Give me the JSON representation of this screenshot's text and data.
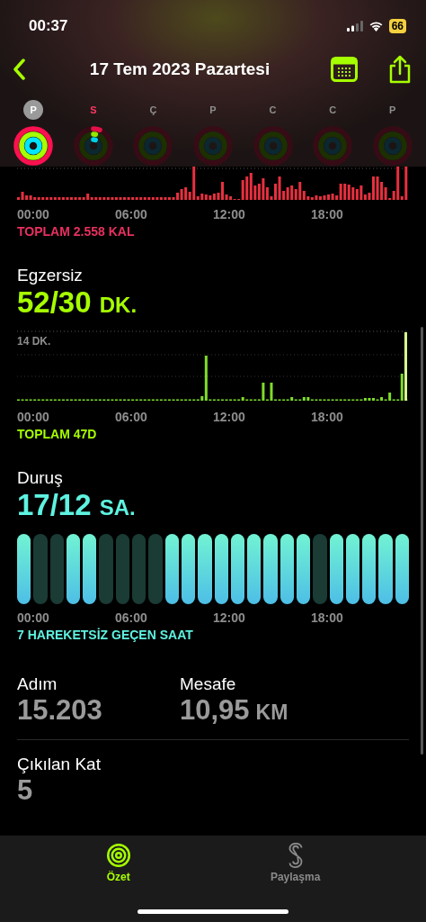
{
  "status_bar": {
    "time": "00:37",
    "battery": "66"
  },
  "nav": {
    "title": "17 Tem 2023 Pazartesi"
  },
  "week": [
    {
      "label": "P",
      "selected": true,
      "accent": false,
      "kind": "closed"
    },
    {
      "label": "S",
      "selected": false,
      "accent": true,
      "kind": "started"
    },
    {
      "label": "Ç",
      "selected": false,
      "accent": false,
      "kind": "empty"
    },
    {
      "label": "P",
      "selected": false,
      "accent": false,
      "kind": "empty"
    },
    {
      "label": "C",
      "selected": false,
      "accent": false,
      "kind": "empty"
    },
    {
      "label": "C",
      "selected": false,
      "accent": false,
      "kind": "empty"
    },
    {
      "label": "P",
      "selected": false,
      "accent": false,
      "kind": "empty"
    }
  ],
  "move": {
    "axis": [
      "00:00",
      "06:00",
      "12:00",
      "18:00"
    ],
    "total": "TOPLAM 2.558 KAL"
  },
  "exercise": {
    "title": "Egzersiz",
    "value": "52/30",
    "unit": "DK.",
    "scale_label": "14 DK.",
    "axis": [
      "00:00",
      "06:00",
      "12:00",
      "18:00"
    ],
    "total": "TOPLAM 47D"
  },
  "stand": {
    "title": "Duruş",
    "value": "17/12",
    "unit": "SA.",
    "hours": [
      {
        "stood": true
      },
      {
        "stood": false
      },
      {
        "stood": false
      },
      {
        "stood": true
      },
      {
        "stood": true
      },
      {
        "stood": false
      },
      {
        "stood": false
      },
      {
        "stood": false
      },
      {
        "stood": false
      },
      {
        "stood": true
      },
      {
        "stood": true
      },
      {
        "stood": true
      },
      {
        "stood": true
      },
      {
        "stood": true
      },
      {
        "stood": true
      },
      {
        "stood": true
      },
      {
        "stood": true
      },
      {
        "stood": true
      },
      {
        "stood": false
      },
      {
        "stood": true
      },
      {
        "stood": true
      },
      {
        "stood": true
      },
      {
        "stood": true
      },
      {
        "stood": true
      }
    ],
    "axis": [
      "00:00",
      "06:00",
      "12:00",
      "18:00"
    ],
    "note": "7 HAREKETSİZ GEÇEN SAAT"
  },
  "stats": [
    {
      "label": "Adım",
      "value": "15.203"
    },
    {
      "label": "Mesafe",
      "value": "10,95",
      "unit": "KM"
    }
  ],
  "floors": {
    "label": "Çıkılan Kat",
    "value": "5"
  },
  "tabs": [
    {
      "label": "Özet",
      "selected": true
    },
    {
      "label": "Paylaşma",
      "selected": false
    }
  ]
}
